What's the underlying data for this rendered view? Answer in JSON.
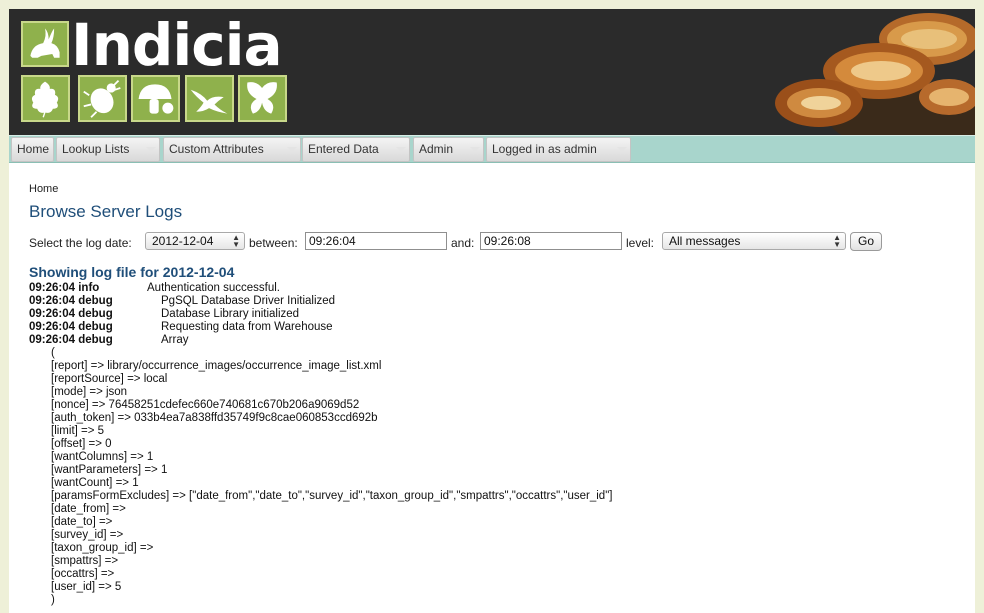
{
  "brand": {
    "name": "Indicia"
  },
  "menu": [
    {
      "label": "Home"
    },
    {
      "label": "Lookup Lists"
    },
    {
      "label": "Custom Attributes"
    },
    {
      "label": "Entered Data"
    },
    {
      "label": "Admin"
    },
    {
      "label": "Logged in as admin"
    }
  ],
  "breadcrumb": "Home",
  "page_title": "Browse Server Logs",
  "filters": {
    "date_label": "Select the log date:",
    "date_value": "2012-12-04",
    "between_label": "between:",
    "from_value": "09:26:04",
    "and_label": "and:",
    "to_value": "09:26:08",
    "level_label": "level:",
    "level_value": "All messages",
    "go_label": "Go"
  },
  "log": {
    "heading": "Showing log file for 2012-12-04",
    "entries": [
      {
        "time": "09:26:04 info",
        "message": "Authentication successful."
      },
      {
        "time": "09:26:04 debug",
        "message": "PgSQL Database Driver Initialized"
      },
      {
        "time": "09:26:04 debug",
        "message": "Database Library initialized"
      },
      {
        "time": "09:26:04 debug",
        "message": "Requesting data from Warehouse"
      },
      {
        "time": "09:26:04 debug",
        "message": "Array"
      }
    ],
    "array_dump": [
      "(",
      "[report] => library/occurrence_images/occurrence_image_list.xml",
      "[reportSource] => local",
      "[mode] => json",
      "[nonce] => 76458251cdefec660e740681c670b206a9069d52",
      "[auth_token] => 033b4ea7a838ffd35749f9c8cae060853ccd692b",
      "[limit] => 5",
      "[offset] => 0",
      "[wantColumns] => 1",
      "[wantParameters] => 1",
      "[wantCount] => 1",
      "[paramsFormExcludes] => [\"date_from\",\"date_to\",\"survey_id\",\"taxon_group_id\",\"smpattrs\",\"occattrs\",\"user_id\"]",
      "[date_from] =>",
      "[date_to] =>",
      "[survey_id] =>",
      "[taxon_group_id] =>",
      "[smpattrs] =>",
      "[occattrs] =>",
      "[user_id] => 5",
      ")"
    ]
  }
}
